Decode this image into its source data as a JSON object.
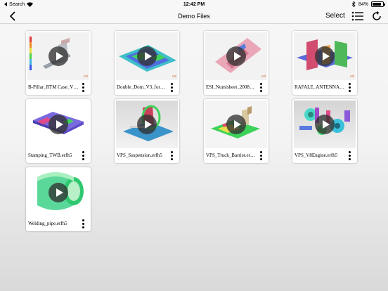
{
  "status_bar": {
    "back_app": "Search",
    "time": "12:42 PM",
    "battery_text": "84%",
    "battery_level": 0.84
  },
  "nav": {
    "title": "Demo Files",
    "select_label": "Select"
  },
  "files": [
    {
      "name": "B-Pillar_RTM Case_V…",
      "thumb": "bpillar-plot"
    },
    {
      "name": "Double_Dom_V3_for…",
      "thumb": "double-dome-mesh"
    },
    {
      "name": "ESI_Numisheet_2008…",
      "thumb": "numisheet-part"
    },
    {
      "name": "RAFALE_ANTENNA.…",
      "thumb": "rafale-antenna"
    },
    {
      "name": "Stamping_TWB.erfh5",
      "thumb": "stamping-blank"
    },
    {
      "name": "VPS_Suspension.erfh5",
      "thumb": "suspension-model"
    },
    {
      "name": "VPS_Truck_Barrier.er…",
      "thumb": "truck-barrier"
    },
    {
      "name": "VPS_V8Engine.erfh5",
      "thumb": "v8-engine"
    },
    {
      "name": "Welding_pipe.erfh5",
      "thumb": "welding-pipe"
    }
  ]
}
